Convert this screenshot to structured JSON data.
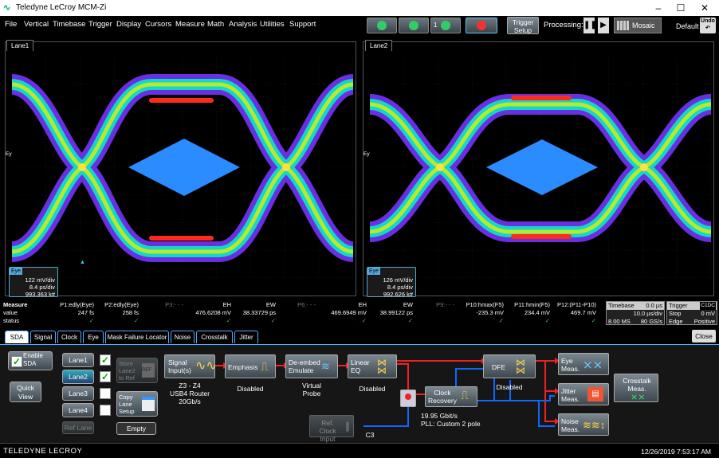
{
  "window": {
    "title": "Teledyne LeCroy MCM-Zi",
    "minimize": "–",
    "maximize": "☐",
    "close": "✕"
  },
  "menu": [
    "File",
    "Vertical",
    "Timebase",
    "Trigger",
    "Display",
    "Cursors",
    "Measure",
    "Math",
    "Analysis",
    "Utilities",
    "Support"
  ],
  "toolbar": {
    "trigger_setup": "Trigger Setup",
    "trigger_l1": "Trigger",
    "trigger_l2": "Setup",
    "processing": "Processing:",
    "mosaic": "Mosaic",
    "default": "Default",
    "undo": "Undo",
    "btn3_label": "1"
  },
  "panels": [
    {
      "tab": "Lane1",
      "eye_label": "Eye",
      "v1": "122 mV/div",
      "v2": "8.4 ps/div",
      "v3": "993.363 k#"
    },
    {
      "tab": "Lane2",
      "eye_label": "Eye",
      "v1": "126 mV/div",
      "v2": "8.4 ps/div",
      "v3": "992.626 k#"
    }
  ],
  "ey_label": "Ey",
  "measure": {
    "row_labels": [
      "Measure",
      "value",
      "status"
    ],
    "cols": [
      {
        "name": "P1:edly(Eye)",
        "value": "247 fs",
        "status": "✓"
      },
      {
        "name": "P2:edly(Eye)",
        "value": "258 fs",
        "status": "✓"
      },
      {
        "name": "P3:- - -",
        "value": "",
        "status": ""
      },
      {
        "name": "EH",
        "value": "476.6208 mV",
        "status": "✓"
      },
      {
        "name": "EW",
        "value": "38.33729 ps",
        "status": "✓"
      },
      {
        "name": "P6:- - -",
        "value": "",
        "status": ""
      },
      {
        "name": "EH",
        "value": "469.6949 mV",
        "status": "✓"
      },
      {
        "name": "EW",
        "value": "38.99122 ps",
        "status": "✓"
      },
      {
        "name": "P9:- - -",
        "value": "",
        "status": ""
      },
      {
        "name": "P10:hmax(F5)",
        "value": "-235.3 mV",
        "status": "✓"
      },
      {
        "name": "P11:hmin(F5)",
        "value": "234.4 mV",
        "status": "✓"
      },
      {
        "name": "P12:(P11-P10)",
        "value": "469.7 mV",
        "status": "✓"
      }
    ],
    "timebase": {
      "title": "Timebase",
      "v1": "0.0 µs",
      "v2": "10.0 µs/div",
      "v3a": "8.00 MS",
      "v3b": "80 GS/s"
    },
    "trigger": {
      "title": "Trigger",
      "badge": "C1DC",
      "v1a": "Stop",
      "v1b": "0 mV",
      "v2a": "Edge",
      "v2b": "Positive"
    }
  },
  "tabs": [
    "SDA",
    "Signal",
    "Clock",
    "Eye",
    "Mask Failure Locator",
    "Noise",
    "Crosstalk",
    "Jitter"
  ],
  "close": "Close",
  "sda": {
    "enable": "Enable SDA",
    "quick_view": "Quick View",
    "lanes": [
      "Lane1",
      "Lane2",
      "Lane3",
      "Lane4"
    ],
    "ref_lane": "Ref Lane",
    "store": "Store Lane2 to Ref",
    "copy": "Copy Lane Setup",
    "empty": "Empty",
    "signal_input": "Signal Input(s)",
    "signal_sub": "Z3 - Z4\nUSB4 Router\n20Gb/s",
    "emphasis": "Emphasis",
    "emphasis_sub": "Disabled",
    "deembed": "De-embed Emulate",
    "deembed_sub": "Virtual Probe",
    "lineq": "Linear EQ",
    "lineq_sub": "Disabled",
    "refclock": "Ref. Clock Input",
    "refclock_sub": "C3",
    "clock": "Clock Recovery",
    "clock_sub": "19.95 Gbit/s\nPLL: Custom 2 pole",
    "dfe": "DFE",
    "dfe_sub": "Disabled",
    "eye_meas": "Eye Meas.",
    "jitter_meas": "Jitter Meas.",
    "noise_meas": "Noise Meas.",
    "crosstalk_meas": "Crosstalk Meas."
  },
  "status": {
    "logo": "TELEDYNE LECROY",
    "datetime": "12/26/2019 7:53:17 AM"
  }
}
